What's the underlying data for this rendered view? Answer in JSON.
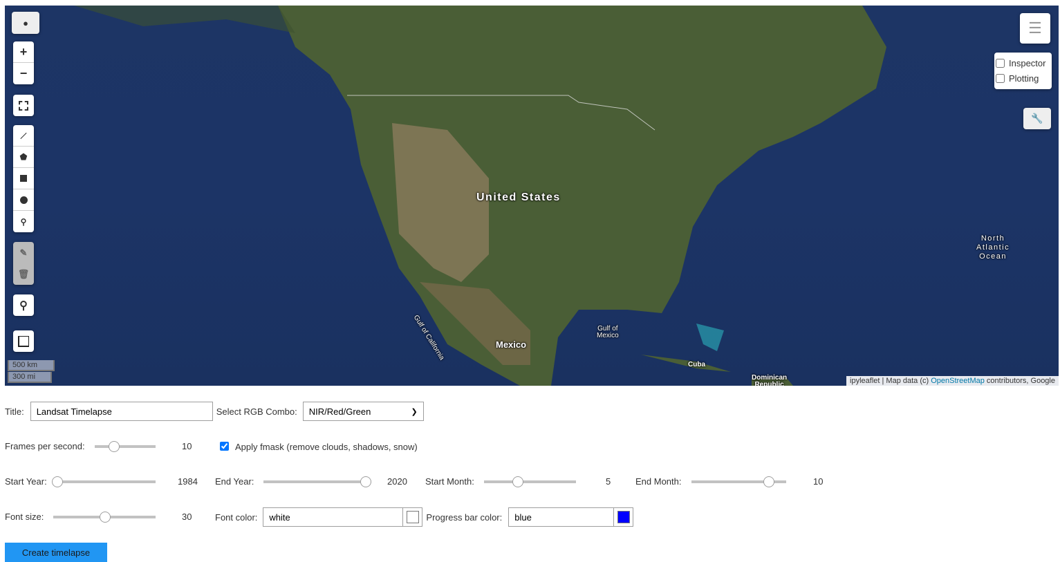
{
  "map": {
    "labels": {
      "us": "United States",
      "mexico": "Mexico",
      "gulf_mexico": "Gulf of\nMexico",
      "gulf_california": "Gulf of California",
      "cuba": "Cuba",
      "dominican": "Dominican\nRepublic",
      "atlantic": "North\nAtlantic\nOcean"
    },
    "scale": {
      "km": "500 km",
      "mi": "300 mi"
    },
    "attribution": {
      "prefix": "ipyleaflet | Map data (c) ",
      "link": "OpenStreetMap",
      "suffix": " contributors, Google"
    },
    "layer_checkboxes": [
      {
        "label": "Inspector",
        "checked": false
      },
      {
        "label": "Plotting",
        "checked": false
      }
    ],
    "controls": [
      "globe-icon",
      "zoom-in",
      "zoom-out",
      "fullscreen",
      "draw-polyline",
      "draw-polygon",
      "draw-rectangle",
      "draw-circle",
      "draw-marker",
      "edit",
      "delete",
      "search",
      "measure",
      "layers",
      "toolbar-wrench"
    ]
  },
  "form": {
    "title_label": "Title:",
    "title_value": "Landsat Timelapse",
    "rgb_label": "Select RGB Combo:",
    "rgb_value": "NIR/Red/Green",
    "fps_label": "Frames per second:",
    "fps_value": "10",
    "fmask_label": "Apply fmask (remove clouds, shadows, snow)",
    "fmask_checked": true,
    "start_year_label": "Start Year:",
    "start_year_value": "1984",
    "end_year_label": "End Year:",
    "end_year_value": "2020",
    "start_month_label": "Start Month:",
    "start_month_value": "5",
    "end_month_label": "End Month:",
    "end_month_value": "10",
    "font_size_label": "Font size:",
    "font_size_value": "30",
    "font_color_label": "Font color:",
    "font_color_value": "white",
    "font_color_swatch": "#ffffff",
    "progress_color_label": "Progress bar color:",
    "progress_color_value": "blue",
    "progress_color_swatch": "#0000ff",
    "create_button": "Create timelapse",
    "button_color": "#2196f3"
  }
}
